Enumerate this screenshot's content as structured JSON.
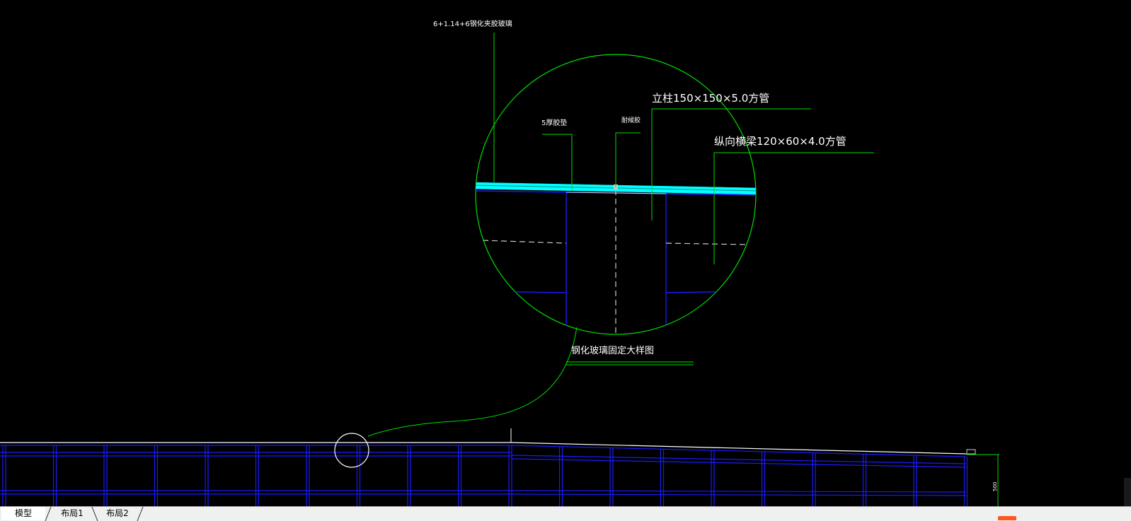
{
  "drawing": {
    "callouts": {
      "glass": "6+1.14+6钢化夹胶玻璃",
      "gasket": "5厚胶垫",
      "sealant": "耐候胶",
      "column": "立柱150×150×5.0方管",
      "beam": "纵向横梁120×60×4.0方管"
    },
    "detail_title": "钢化玻璃固定大样图",
    "dimension_value": "500"
  },
  "tabs": [
    {
      "label": "模型",
      "active": true
    },
    {
      "label": "布局1",
      "active": false
    },
    {
      "label": "布局2",
      "active": false
    }
  ],
  "colors": {
    "background": "#000000",
    "leader_green": "#00e000",
    "glass_cyan": "#00ffff",
    "frame_blue": "#1a1aff",
    "text_white": "#ffffff"
  }
}
